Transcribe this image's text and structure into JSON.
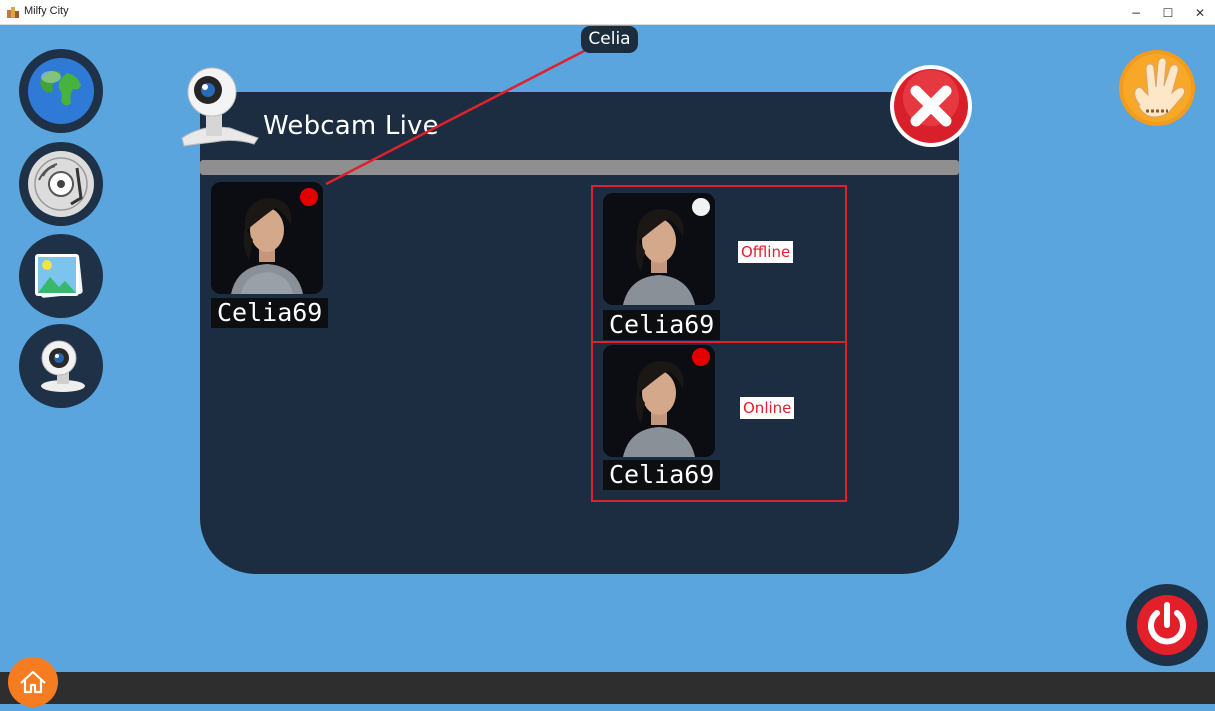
{
  "window": {
    "title": "Milfy City",
    "minimize": "−",
    "maximize": "☐",
    "close": "✕"
  },
  "sidebar": [
    {
      "name": "globe",
      "icon": "globe-icon"
    },
    {
      "name": "music",
      "icon": "vinyl-record-icon"
    },
    {
      "name": "gallery",
      "icon": "photo-gallery-icon"
    },
    {
      "name": "webcam",
      "icon": "webcam-icon"
    }
  ],
  "panel": {
    "title": "Webcam Live",
    "close_icon": "close-x-icon"
  },
  "contacts": [
    {
      "name": "Celia69",
      "online": true
    }
  ],
  "annotations": {
    "tooltip": "Celia",
    "examples": [
      {
        "name": "Celia69",
        "status_label": "Offline",
        "online": false
      },
      {
        "name": "Celia69",
        "status_label": "Online",
        "online": true
      }
    ]
  },
  "buttons": {
    "hand_icon": "hand-icon",
    "power_icon": "power-icon",
    "home_icon": "home-icon"
  },
  "colors": {
    "background": "#5aa5de",
    "panel": "#1c2d41",
    "online_dot": "#e00000",
    "offline_dot": "#f2f2f2",
    "annotation": "#e0202d"
  }
}
